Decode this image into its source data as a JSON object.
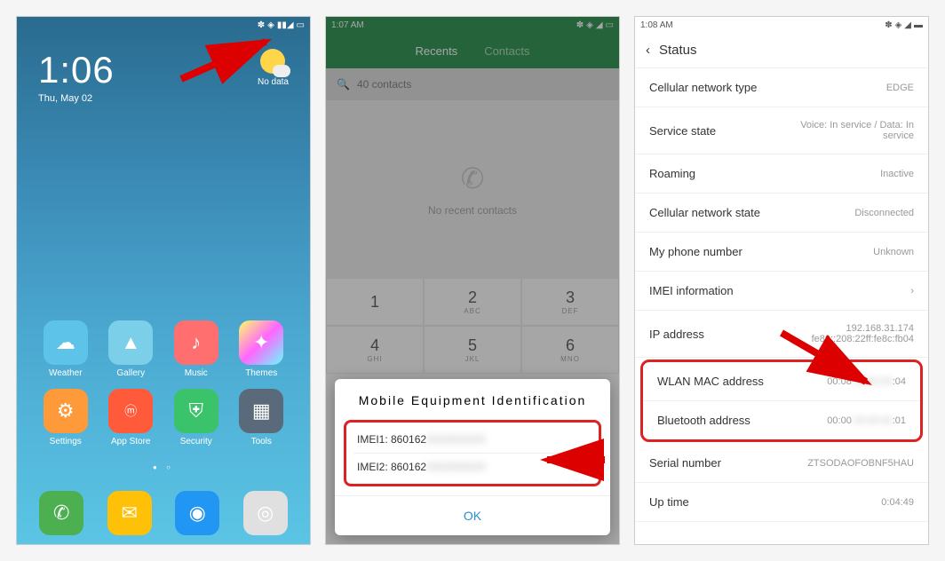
{
  "screen1": {
    "status_time": "",
    "clock": "1:06",
    "date": "Thu, May 02",
    "weather_label": "No data",
    "apps": [
      {
        "label": "Weather",
        "color": "#5ec3e8"
      },
      {
        "label": "Gallery",
        "color": "#7bcfe8"
      },
      {
        "label": "Music",
        "color": "#ff6f6f"
      },
      {
        "label": "Themes",
        "color": "#ffd84a"
      },
      {
        "label": "Settings",
        "color": "#ff9a3a"
      },
      {
        "label": "App Store",
        "color": "#ff5a3a"
      },
      {
        "label": "Security",
        "color": "#3ac36b"
      },
      {
        "label": "Tools",
        "color": "#5a6a7a"
      }
    ]
  },
  "screen2": {
    "status_time": "1:07 AM",
    "tab_recents": "Recents",
    "tab_contacts": "Contacts",
    "search": "40 contacts",
    "no_recent": "No recent contacts",
    "keys": [
      {
        "n": "1",
        "s": ""
      },
      {
        "n": "2",
        "s": "ABC"
      },
      {
        "n": "3",
        "s": "DEF"
      },
      {
        "n": "4",
        "s": "GHI"
      },
      {
        "n": "5",
        "s": "JKL"
      },
      {
        "n": "6",
        "s": "MNO"
      }
    ],
    "dialog_title": "Mobile Equipment Identification",
    "imei1": "IMEI1: 860162",
    "imei2": "IMEI2: 860162",
    "ok": "OK"
  },
  "screen3": {
    "status_time": "1:08 AM",
    "header": "Status",
    "rows": {
      "cell_type": {
        "l": "Cellular network type",
        "v": "EDGE"
      },
      "service": {
        "l": "Service state",
        "v": "Voice: In service / Data: In service"
      },
      "roaming": {
        "l": "Roaming",
        "v": "Inactive"
      },
      "cell_state": {
        "l": "Cellular network state",
        "v": "Disconnected"
      },
      "phone_num": {
        "l": "My phone number",
        "v": "Unknown"
      },
      "imei_info": {
        "l": "IMEI information",
        "v": "›"
      },
      "ip": {
        "l": "IP address",
        "v": "192.168.31.174\nfe80::208:22ff:fe8c:fb04"
      },
      "wlan": {
        "l": "WLAN MAC address",
        "v_pre": "00:08",
        "v_post": ":04"
      },
      "bt": {
        "l": "Bluetooth address",
        "v_pre": "00:00",
        "v_post": ":01"
      },
      "serial": {
        "l": "Serial number",
        "v": "ZTSODAOFOBNF5HAU"
      },
      "uptime": {
        "l": "Up time",
        "v": "0:04:49"
      }
    }
  }
}
